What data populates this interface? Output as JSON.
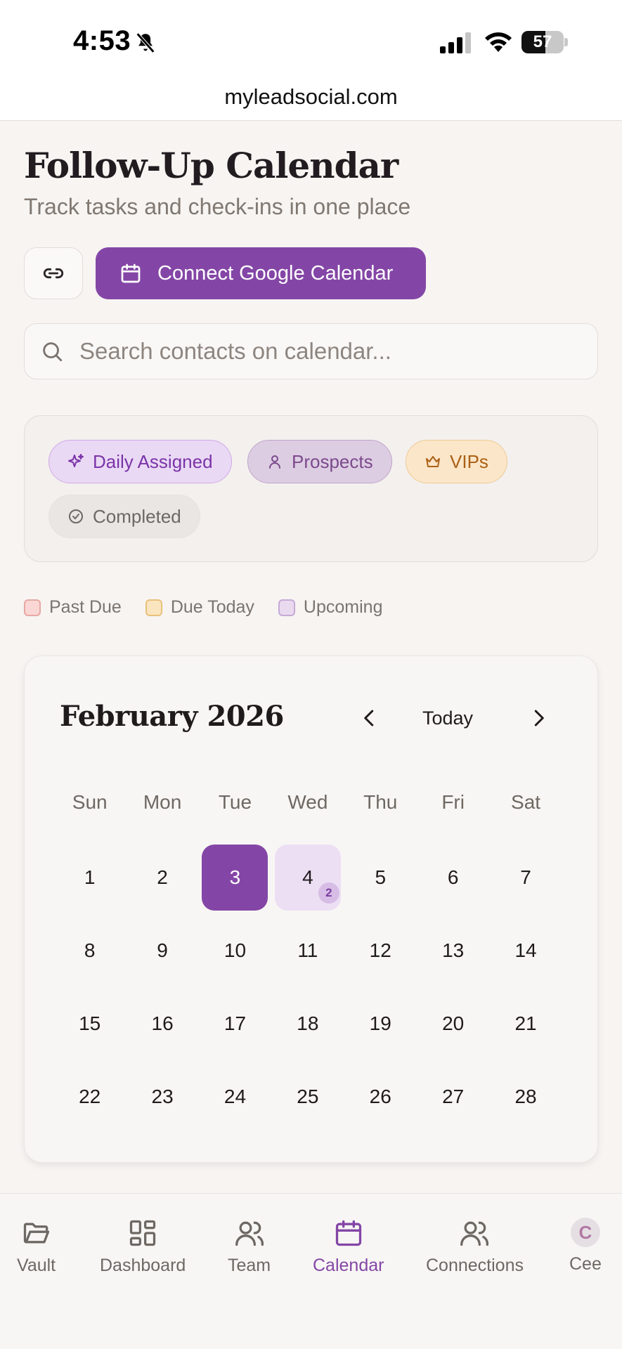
{
  "status_bar": {
    "time": "4:53",
    "battery": "57",
    "battery_level": 0.57
  },
  "browser": {
    "url": "myleadsocial.com"
  },
  "header": {
    "title": "Follow-Up Calendar",
    "subtitle": "Track tasks and check-ins in one place"
  },
  "actions": {
    "connect_label": "Connect Google Calendar"
  },
  "search": {
    "placeholder": "Search contacts on calendar..."
  },
  "filters": {
    "daily": "Daily Assigned",
    "prospects": "Prospects",
    "vips": "VIPs",
    "completed": "Completed"
  },
  "legend": {
    "past_due": "Past Due",
    "due_today": "Due Today",
    "upcoming": "Upcoming"
  },
  "calendar": {
    "month_label": "February 2026",
    "today_label": "Today",
    "weekdays": [
      "Sun",
      "Mon",
      "Tue",
      "Wed",
      "Thu",
      "Fri",
      "Sat"
    ],
    "days": [
      {
        "label": "1"
      },
      {
        "label": "2"
      },
      {
        "label": "3",
        "selected": true
      },
      {
        "label": "4",
        "events": "2"
      },
      {
        "label": "5"
      },
      {
        "label": "6"
      },
      {
        "label": "7"
      },
      {
        "label": "8"
      },
      {
        "label": "9"
      },
      {
        "label": "10"
      },
      {
        "label": "11"
      },
      {
        "label": "12"
      },
      {
        "label": "13"
      },
      {
        "label": "14"
      },
      {
        "label": "15"
      },
      {
        "label": "16"
      },
      {
        "label": "17"
      },
      {
        "label": "18"
      },
      {
        "label": "19"
      },
      {
        "label": "20"
      },
      {
        "label": "21"
      },
      {
        "label": "22"
      },
      {
        "label": "23"
      },
      {
        "label": "24"
      },
      {
        "label": "25"
      },
      {
        "label": "26"
      },
      {
        "label": "27"
      },
      {
        "label": "28"
      }
    ]
  },
  "nav": {
    "vault": "Vault",
    "dashboard": "Dashboard",
    "team": "Team",
    "calendar": "Calendar",
    "connections": "Connections",
    "profile": "Cee",
    "avatar_initial": "C"
  },
  "colors": {
    "accent": "#8446a6",
    "background": "#f7f4f2"
  }
}
